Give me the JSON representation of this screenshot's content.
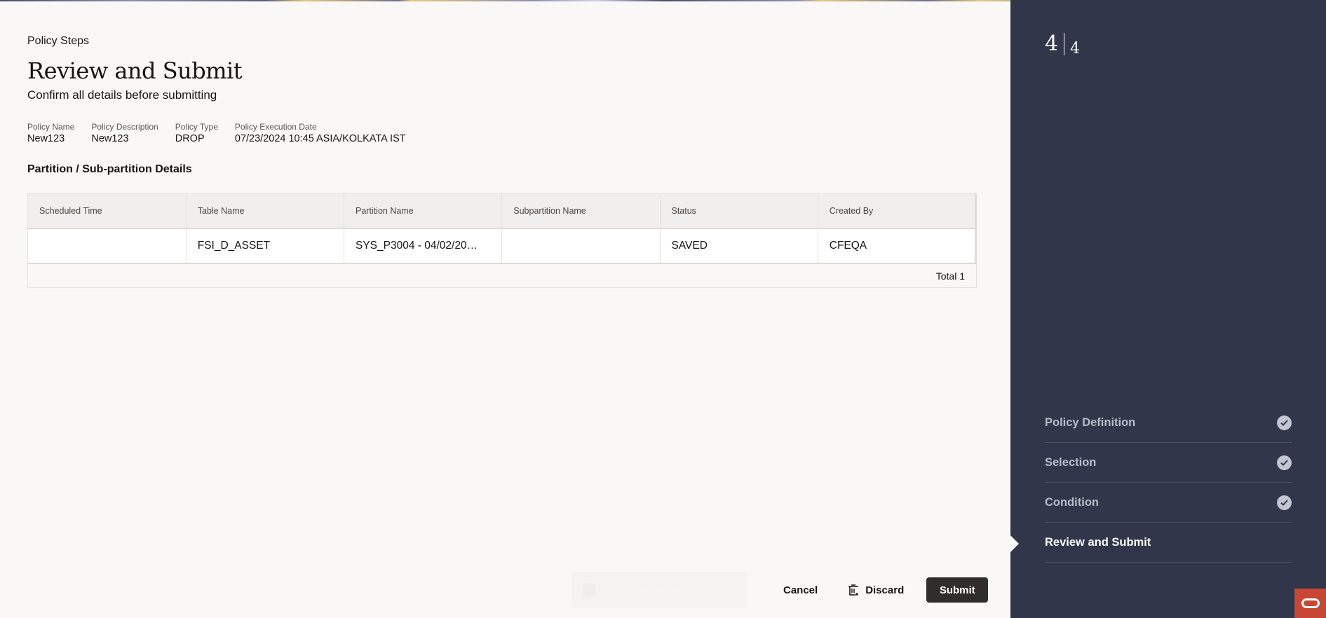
{
  "page": {
    "eyebrow": "Policy Steps",
    "title": "Review and Submit",
    "subtitle": "Confirm all details before submitting"
  },
  "summary": [
    {
      "label": "Policy Name",
      "value": "New123"
    },
    {
      "label": "Policy Description",
      "value": "New123"
    },
    {
      "label": "Policy Type",
      "value": "DROP"
    },
    {
      "label": "Policy Execution Date",
      "value": "07/23/2024 10:45 ASIA/KOLKATA IST"
    }
  ],
  "section": {
    "title": "Partition / Sub-partition Details"
  },
  "table": {
    "columns": [
      "Scheduled Time",
      "Table Name",
      "Partition Name",
      "Subpartition Name",
      "Status",
      "Created By"
    ],
    "rows": [
      [
        "",
        "FSI_D_ASSET",
        "SYS_P3004 - 04/02/20…",
        "",
        "SAVED",
        "CFEQA"
      ]
    ],
    "footer": "Total 1"
  },
  "toast": {
    "icon": "check-circle-icon",
    "message": "Details saved successfully"
  },
  "actions": {
    "cancel": "Cancel",
    "discard": "Discard",
    "discard_icon": "trash-icon",
    "submit": "Submit"
  },
  "sidebar": {
    "current_step": "4",
    "total_steps": "4",
    "steps": [
      {
        "label": "Policy Definition",
        "status": "complete",
        "icon": "check-circle-icon"
      },
      {
        "label": "Selection",
        "status": "complete",
        "icon": "check-circle-icon"
      },
      {
        "label": "Condition",
        "status": "complete",
        "icon": "check-circle-icon"
      },
      {
        "label": "Review and Submit",
        "status": "active"
      }
    ]
  },
  "colors": {
    "sidebar_bg": "#31364b",
    "primary_button": "#312d2a",
    "brand": "#c74634",
    "page_bg": "#f9f8f6"
  }
}
